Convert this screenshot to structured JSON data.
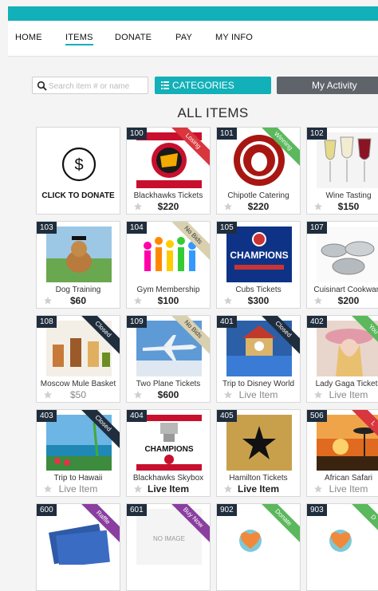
{
  "nav": {
    "items": [
      {
        "label": "HOME"
      },
      {
        "label": "ITEMS"
      },
      {
        "label": "DONATE"
      },
      {
        "label": "PAY"
      },
      {
        "label": "MY INFO"
      }
    ]
  },
  "toolbar": {
    "search_placeholder": "Search item # or name",
    "categories_label": "CATEGORIES",
    "activity_label": "My Activity"
  },
  "heading": "ALL ITEMS",
  "donate_card": {
    "label": "CLICK TO DONATE",
    "icon": "dollar-circle-icon"
  },
  "items": [
    {
      "num": "100",
      "title": "Blackhawks Tickets",
      "price": "$220",
      "ribbon": "Losing",
      "ribbon_color": "#d9363e"
    },
    {
      "num": "101",
      "title": "Chipotle Catering",
      "price": "$220",
      "ribbon": "Winning",
      "ribbon_color": "#5bb85c"
    },
    {
      "num": "102",
      "title": "Wine Tasting",
      "price": "$150",
      "ribbon": "",
      "ribbon_color": ""
    },
    {
      "num": "103",
      "title": "Dog Training",
      "price": "$60",
      "ribbon": "",
      "ribbon_color": ""
    },
    {
      "num": "104",
      "title": "Gym Membership",
      "price": "$100",
      "ribbon": "No Bids",
      "ribbon_color": "#d9d0b0"
    },
    {
      "num": "105",
      "title": "Cubs Tickets",
      "price": "$300",
      "ribbon": "",
      "ribbon_color": ""
    },
    {
      "num": "107",
      "title": "Cuisinart Cookware",
      "price": "$200",
      "ribbon": "",
      "ribbon_color": ""
    },
    {
      "num": "108",
      "title": "Moscow Mule Basket",
      "price": "$50",
      "ribbon": "Closed",
      "ribbon_color": "#1f2d3d"
    },
    {
      "num": "109",
      "title": "Two Plane Tickets",
      "price": "$600",
      "ribbon": "No Bids",
      "ribbon_color": "#d9d0b0"
    },
    {
      "num": "401",
      "title": "Trip to Disney World",
      "price": "Live Item",
      "ribbon": "Closed",
      "ribbon_color": "#1f2d3d"
    },
    {
      "num": "402",
      "title": "Lady Gaga Tickets",
      "price": "Live Item",
      "ribbon": "You",
      "ribbon_color": "#5bb85c"
    },
    {
      "num": "403",
      "title": "Trip to Hawaii",
      "price": "Live Item",
      "ribbon": "Closed",
      "ribbon_color": "#1f2d3d"
    },
    {
      "num": "404",
      "title": "Blackhawks Skybox",
      "price": "Live Item",
      "ribbon": "",
      "ribbon_color": ""
    },
    {
      "num": "405",
      "title": "Hamilton Tickets",
      "price": "Live Item",
      "ribbon": "",
      "ribbon_color": ""
    },
    {
      "num": "506",
      "title": "African Safari",
      "price": "Live Item",
      "ribbon": "L",
      "ribbon_color": "#d9363e"
    },
    {
      "num": "600",
      "title": "",
      "price": "",
      "ribbon": "Raffle",
      "ribbon_color": "#8a3fa0"
    },
    {
      "num": "601",
      "title": "",
      "price": "",
      "ribbon": "Buy Now",
      "ribbon_color": "#8a3fa0",
      "image_text": "NO IMAGE"
    },
    {
      "num": "902",
      "title": "",
      "price": "",
      "ribbon": "Donate",
      "ribbon_color": "#5bb85c"
    },
    {
      "num": "903",
      "title": "",
      "price": "",
      "ribbon": "D",
      "ribbon_color": "#5bb85c"
    }
  ],
  "colors": {
    "accent": "#12b0b8",
    "badge": "#1f2d3d",
    "activity": "#5f636a"
  }
}
